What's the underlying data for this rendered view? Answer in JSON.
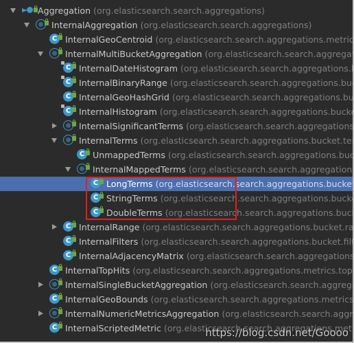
{
  "tree": {
    "items": [
      {
        "name": "Aggregation",
        "pkg": "(org.elasticsearch.search.aggregations)",
        "depth": 0,
        "arrow": "expanded",
        "icon": "package-arrow-icon",
        "selected": false
      },
      {
        "name": "InternalAggregation",
        "pkg": "(org.elasticsearch.search.aggregations)",
        "depth": 1,
        "arrow": "expanded",
        "icon": "abstract-class-icon",
        "selected": false
      },
      {
        "name": "InternalGeoCentroid",
        "pkg": "(org.elasticsearch.search.aggregations.metrics.geocentroid)",
        "depth": 2,
        "arrow": "none",
        "icon": "class-icon",
        "selected": false
      },
      {
        "name": "InternalMultiBucketAggregation",
        "pkg": "(org.elasticsearch.search.aggregations)",
        "depth": 2,
        "arrow": "expanded",
        "icon": "abstract-class-icon",
        "selected": false
      },
      {
        "name": "InternalDateHistogram",
        "pkg": "(org.elasticsearch.search.aggregations.bucket.histogram)",
        "depth": 3,
        "arrow": "none",
        "icon": "final-class-icon",
        "selected": false
      },
      {
        "name": "InternalBinaryRange",
        "pkg": "(org.elasticsearch.search.aggregations.bucket.range)",
        "depth": 3,
        "arrow": "none",
        "icon": "final-class-icon",
        "selected": false
      },
      {
        "name": "InternalGeoHashGrid",
        "pkg": "(org.elasticsearch.search.aggregations.bucket.geogrid)",
        "depth": 3,
        "arrow": "none",
        "icon": "class-icon",
        "selected": false
      },
      {
        "name": "InternalHistogram",
        "pkg": "(org.elasticsearch.search.aggregations.bucket.histogram)",
        "depth": 3,
        "arrow": "none",
        "icon": "final-class-icon",
        "selected": false
      },
      {
        "name": "InternalSignificantTerms",
        "pkg": "(org.elasticsearch.search.aggregations.bucket.significant)",
        "depth": 3,
        "arrow": "collapsed",
        "icon": "abstract-class-icon",
        "selected": false
      },
      {
        "name": "InternalTerms",
        "pkg": "(org.elasticsearch.search.aggregations.bucket.terms)",
        "depth": 3,
        "arrow": "expanded",
        "icon": "abstract-class-icon",
        "selected": false
      },
      {
        "name": "UnmappedTerms",
        "pkg": "(org.elasticsearch.search.aggregations.bucket.terms)",
        "depth": 4,
        "arrow": "none",
        "icon": "class-icon",
        "selected": false
      },
      {
        "name": "InternalMappedTerms",
        "pkg": "(org.elasticsearch.search.aggregations.bucket.terms)",
        "depth": 4,
        "arrow": "expanded",
        "icon": "abstract-class-icon",
        "selected": false
      },
      {
        "name": "LongTerms",
        "pkg": "(org.elasticsearch.search.aggregations.bucket.terms)",
        "depth": 5,
        "arrow": "none",
        "icon": "class-icon",
        "selected": true
      },
      {
        "name": "StringTerms",
        "pkg": "(org.elasticsearch.search.aggregations.bucket.terms)",
        "depth": 5,
        "arrow": "none",
        "icon": "class-icon",
        "selected": false
      },
      {
        "name": "DoubleTerms",
        "pkg": "(org.elasticsearch.search.aggregations.bucket.terms)",
        "depth": 5,
        "arrow": "none",
        "icon": "class-icon",
        "selected": false
      },
      {
        "name": "InternalRange",
        "pkg": "(org.elasticsearch.search.aggregations.bucket.range)",
        "depth": 3,
        "arrow": "collapsed",
        "icon": "class-icon",
        "selected": false
      },
      {
        "name": "InternalFilters",
        "pkg": "(org.elasticsearch.search.aggregations.bucket.filters)",
        "depth": 3,
        "arrow": "none",
        "icon": "class-icon",
        "selected": false
      },
      {
        "name": "InternalAdjacencyMatrix",
        "pkg": "(org.elasticsearch.search.aggregations.bucket.adjacency)",
        "depth": 3,
        "arrow": "none",
        "icon": "class-icon",
        "selected": false
      },
      {
        "name": "InternalTopHits",
        "pkg": "(org.elasticsearch.search.aggregations.metrics.tophits)",
        "depth": 2,
        "arrow": "none",
        "icon": "class-icon",
        "selected": false
      },
      {
        "name": "InternalSingleBucketAggregation",
        "pkg": "(org.elasticsearch.search.aggregations.bucket)",
        "depth": 2,
        "arrow": "collapsed",
        "icon": "abstract-class-icon",
        "selected": false
      },
      {
        "name": "InternalGeoBounds",
        "pkg": "(org.elasticsearch.search.aggregations.metrics.geobounds)",
        "depth": 2,
        "arrow": "none",
        "icon": "class-icon",
        "selected": false
      },
      {
        "name": "InternalNumericMetricsAggregation",
        "pkg": "(org.elasticsearch.search.aggregations.metrics)",
        "depth": 2,
        "arrow": "collapsed",
        "icon": "abstract-class-icon",
        "selected": false
      },
      {
        "name": "InternalScriptedMetric",
        "pkg": "(org.elasticsearch.search.aggregations.metrics.scripted)",
        "depth": 2,
        "arrow": "none",
        "icon": "class-icon",
        "selected": false
      }
    ]
  },
  "watermark": "https://blog.csdn.net/Goooo",
  "colors": {
    "background": "#2b2b2b",
    "selection": "#4b6eaf",
    "highlight_box": "#e02020",
    "class_icon": "#3d98c7",
    "access_lock": "#6aa64a"
  }
}
